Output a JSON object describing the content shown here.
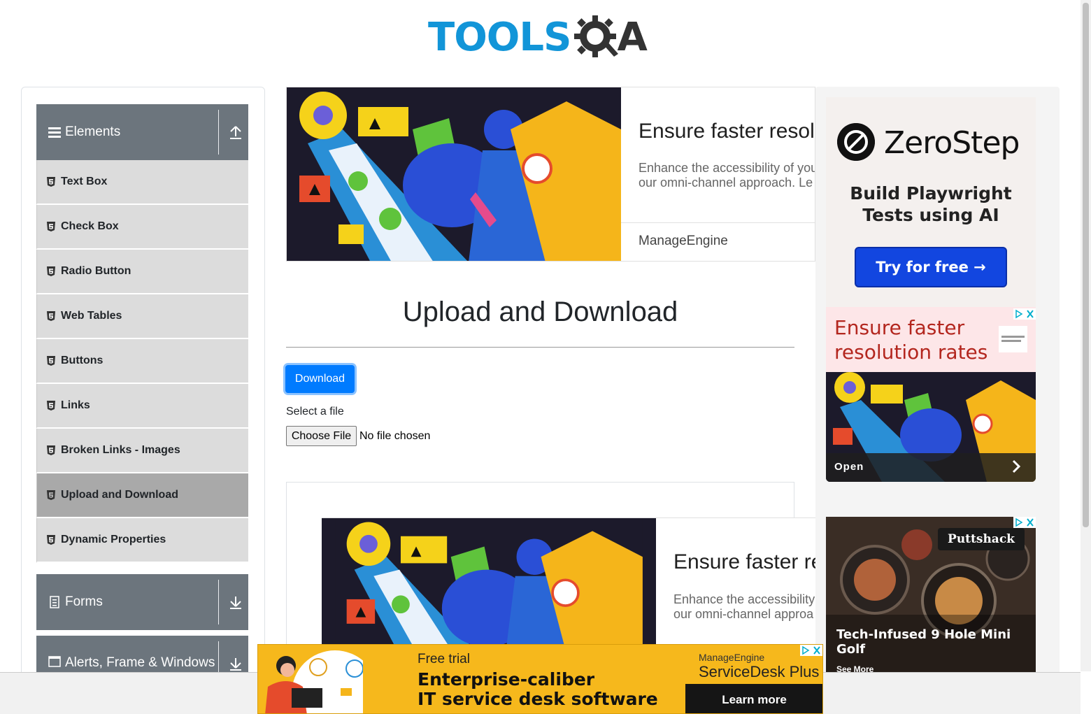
{
  "header": {
    "logo_left": "TOOLS",
    "logo_right": "A"
  },
  "sidebar": {
    "groups": [
      {
        "title": "Elements"
      },
      {
        "title": "Forms"
      },
      {
        "title": "Alerts, Frame & Windows"
      }
    ],
    "items": [
      {
        "label": "Text Box"
      },
      {
        "label": "Check Box"
      },
      {
        "label": "Radio Button"
      },
      {
        "label": "Web Tables"
      },
      {
        "label": "Buttons"
      },
      {
        "label": "Links"
      },
      {
        "label": "Broken Links - Images"
      },
      {
        "label": "Upload and Download",
        "active": true
      },
      {
        "label": "Dynamic Properties"
      }
    ]
  },
  "ad_top": {
    "headline": "Ensure faster resolu",
    "body_line1": "Enhance the accessibility of you",
    "body_line2": "our omni-channel approach. Le",
    "brand": "ManageEngine"
  },
  "main": {
    "title": "Upload and Download",
    "download_label": "Download",
    "file_label": "Select a file",
    "choose_label": "Choose File",
    "no_file": "No file chosen"
  },
  "ad_mid": {
    "headline": "Ensure faster re",
    "body_line1": "Enhance the accessibility",
    "body_line2": "our omni-channel approa"
  },
  "right_ads": {
    "zerostep_name": "ZeroStep",
    "zerostep_sub_line1": "Build Playwright",
    "zerostep_sub_line2": "Tests using AI",
    "zerostep_cta": "Try for free →",
    "me_title_line1": "Ensure faster",
    "me_title_line2": "resolution rates",
    "me_open": "Open",
    "puttshack_brand": "Puttshack",
    "puttshack_headline": "Tech-Infused 9 Hole Mini Golf",
    "puttshack_more": "See More"
  },
  "bottom_ad": {
    "free": "Free trial",
    "line1": "Enterprise-caliber",
    "line2": "IT service desk software",
    "brand1": "ManageEngine",
    "brand2": "ServiceDesk Plus",
    "cta": "Learn more"
  },
  "colors": {
    "brand_blue": "#1295d8",
    "sidebar_header": "#6c757d",
    "menu_item": "#dcdcdc",
    "menu_active": "#a9a9a9",
    "primary_button": "#007bff"
  }
}
